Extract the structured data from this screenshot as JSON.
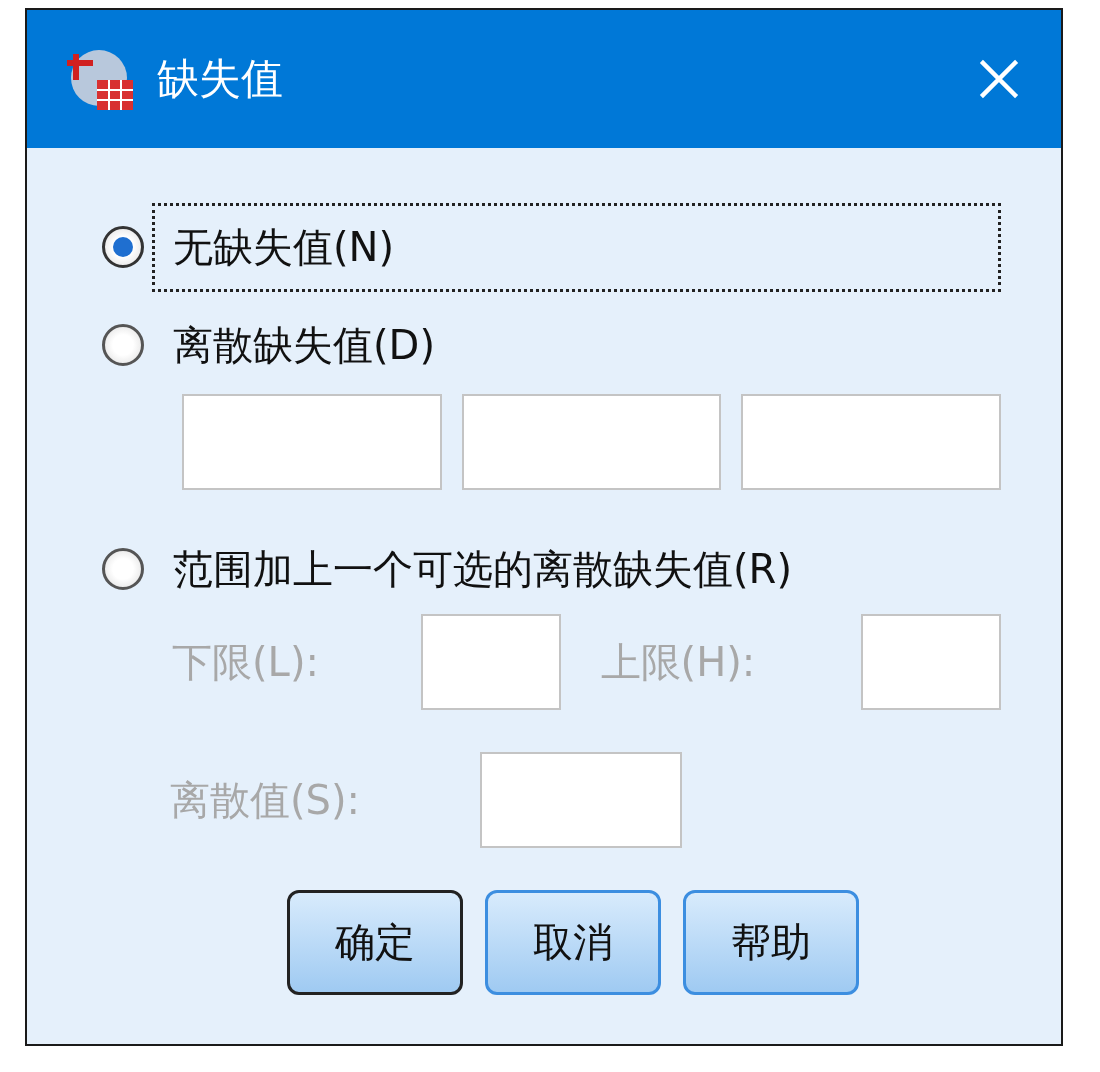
{
  "window": {
    "title": "缺失值"
  },
  "options": [
    {
      "label": "无缺失值(N)",
      "selected": true,
      "focused": true
    },
    {
      "label": "离散缺失值(D)",
      "selected": false,
      "focused": false
    },
    {
      "label": "范围加上一个可选的离散缺失值(R)",
      "selected": false,
      "focused": false
    }
  ],
  "range": {
    "low_label": "下限(L):",
    "high_label": "上限(H):",
    "discrete_label": "离散值(S):",
    "disabled": true
  },
  "buttons": [
    {
      "label": "确定",
      "default": true
    },
    {
      "label": "取消",
      "default": false
    },
    {
      "label": "帮助",
      "default": false
    }
  ]
}
